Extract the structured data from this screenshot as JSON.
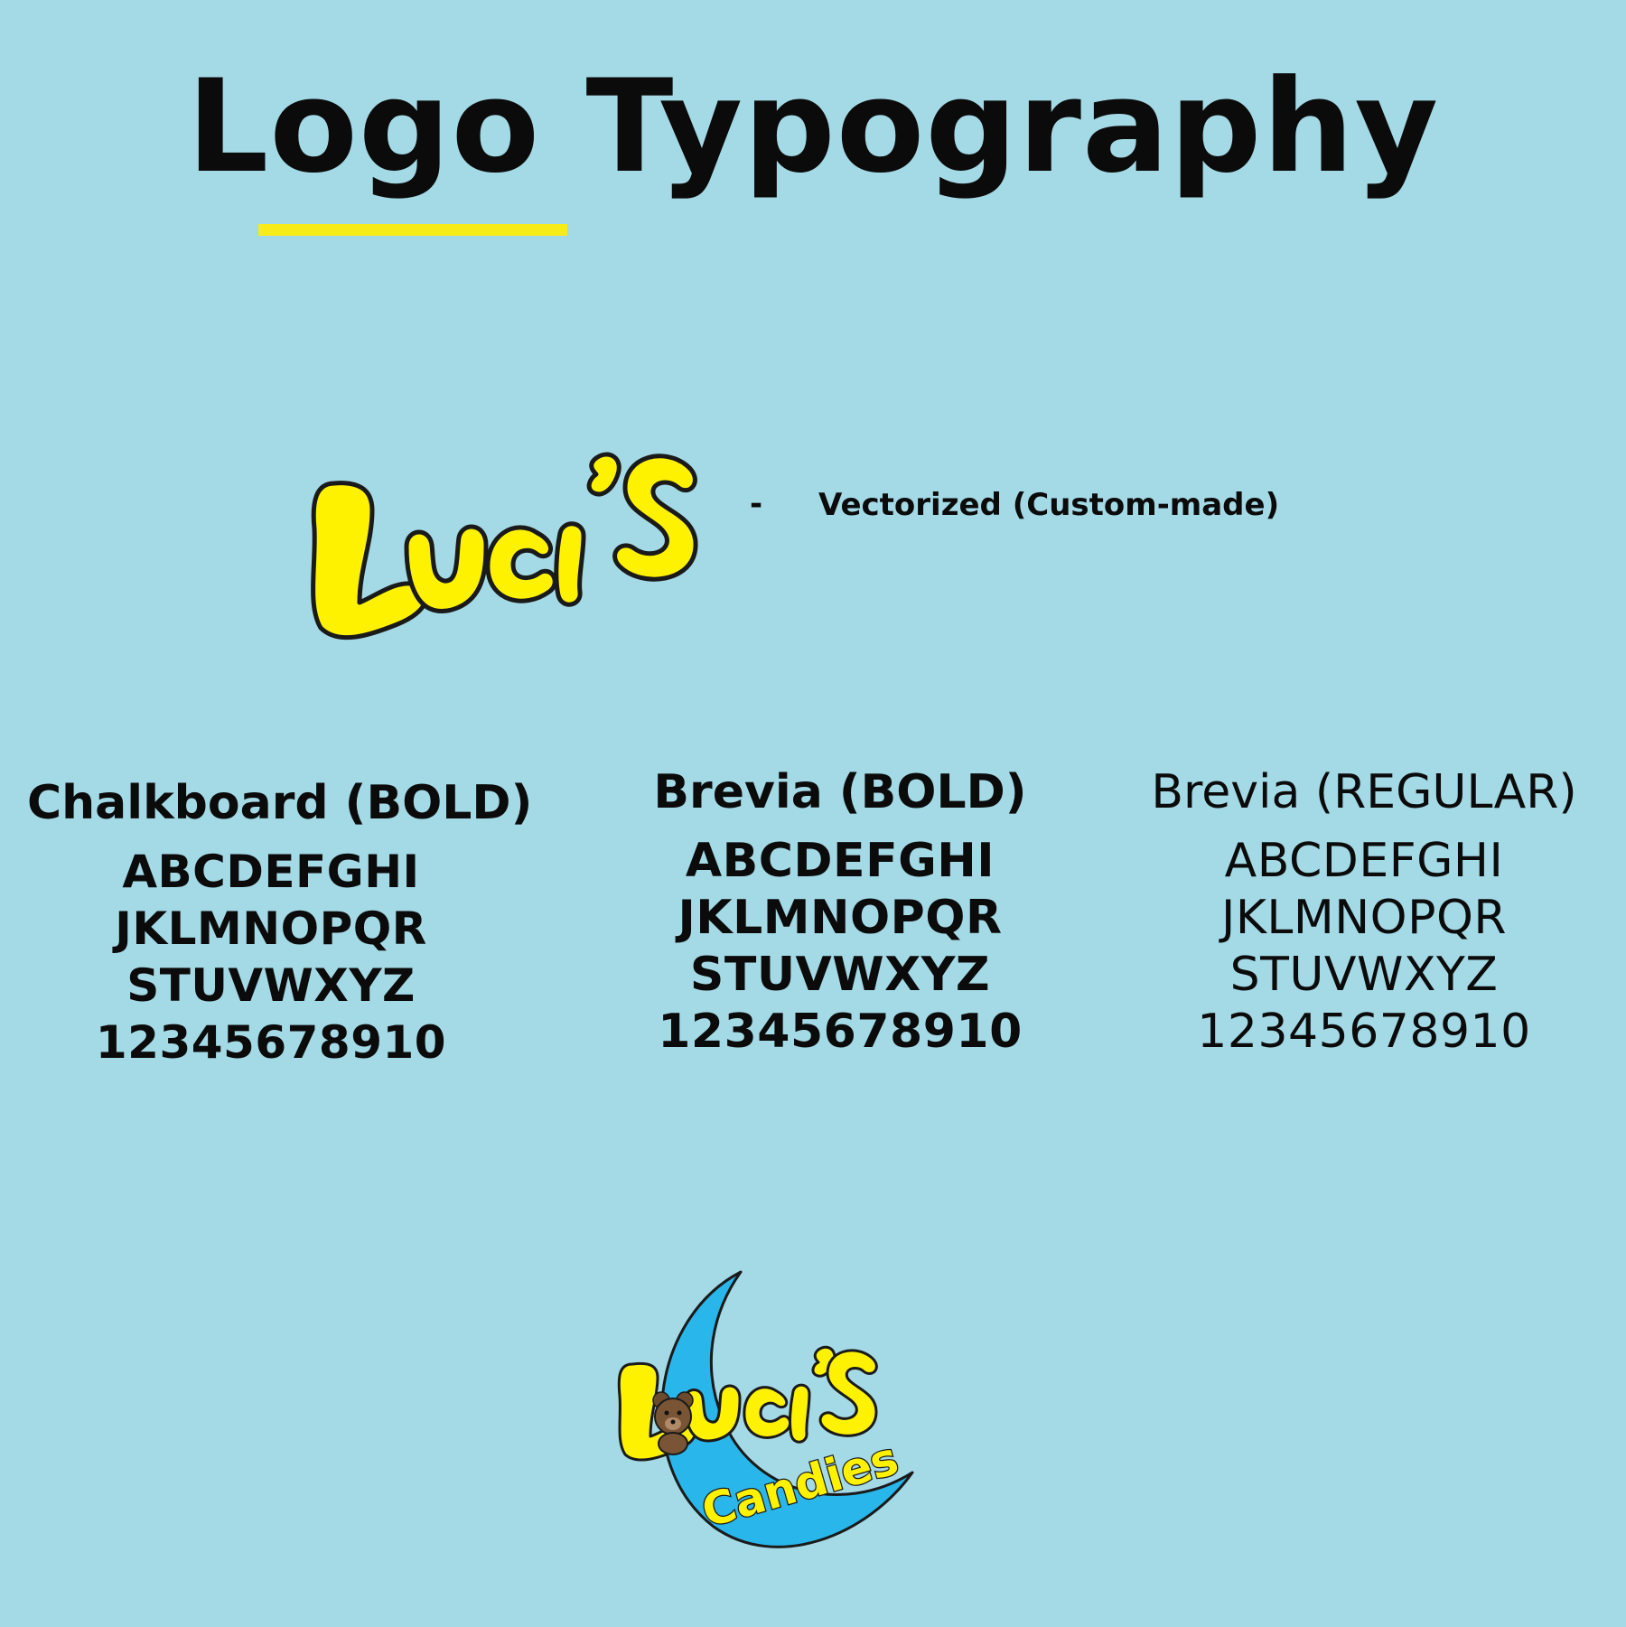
{
  "page": {
    "title": "Logo Typography",
    "background": "#a4d9e6",
    "accent_underline": "#f7ec1a"
  },
  "logo_section": {
    "logo_wordmark": "Luci's",
    "dash": "-",
    "description": "Vectorized (Custom-made)",
    "logo_fill": "#fff200",
    "logo_stroke": "#1a1a1a"
  },
  "fonts": [
    {
      "name": "Chalkboard (BOLD)",
      "lines": [
        "ABCDEFGHI",
        "JKLMNOPQR",
        "STUVWXYZ",
        "12345678910"
      ]
    },
    {
      "name": "Brevia (BOLD)",
      "lines": [
        "ABCDEFGHI",
        "JKLMNOPQR",
        "STUVWXYZ",
        "12345678910"
      ]
    },
    {
      "name": "Brevia (REGULAR)",
      "lines": [
        "ABCDEFGHI",
        "JKLMNOPQR",
        "STUVWXYZ",
        "12345678910"
      ]
    }
  ],
  "bottom_logo": {
    "wordmark": "Luci's",
    "subtitle": "Candies",
    "moon_color": "#29b6ea",
    "text_color": "#fff200",
    "bear_icon": "teddy-bear-icon"
  }
}
